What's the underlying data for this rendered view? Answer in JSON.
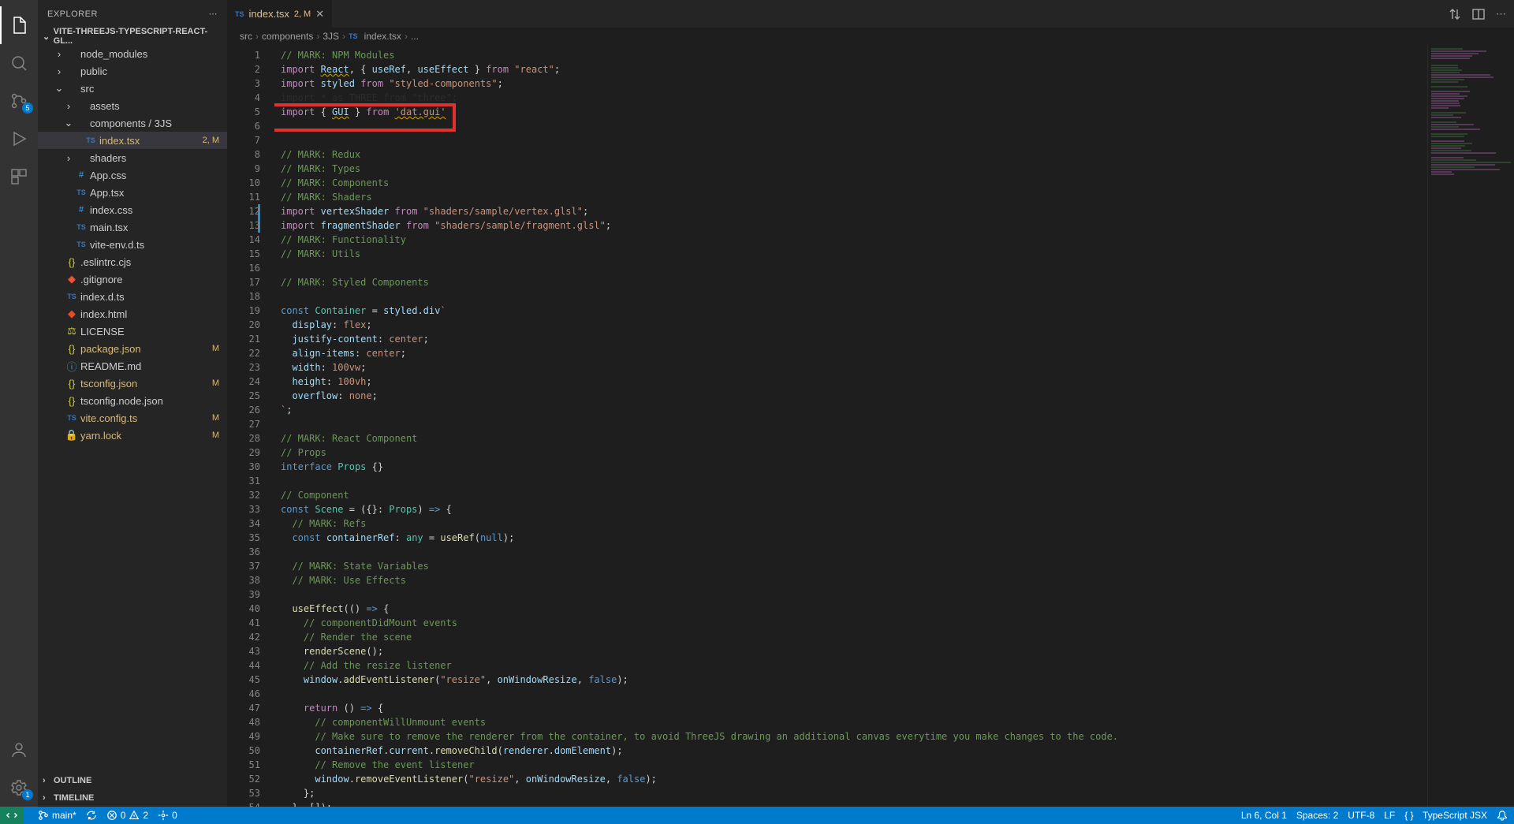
{
  "explorer": {
    "title": "EXPLORER",
    "project": "VITE-THREEJS-TYPESCRIPT-REACT-GL...",
    "outline": "OUTLINE",
    "timeline": "TIMELINE"
  },
  "tree": [
    {
      "depth": 1,
      "chev": "›",
      "icon": "folder",
      "label": "node_modules",
      "cls": ""
    },
    {
      "depth": 1,
      "chev": "›",
      "icon": "folder",
      "label": "public",
      "cls": ""
    },
    {
      "depth": 1,
      "chev": "⌄",
      "icon": "folder",
      "label": "src",
      "cls": ""
    },
    {
      "depth": 2,
      "chev": "›",
      "icon": "folder",
      "label": "assets",
      "cls": ""
    },
    {
      "depth": 2,
      "chev": "⌄",
      "icon": "folder",
      "label": "components / 3JS",
      "cls": ""
    },
    {
      "depth": 3,
      "chev": "",
      "icon": "ts",
      "label": "index.tsx",
      "cls": "mod",
      "status": "2, M",
      "selected": true
    },
    {
      "depth": 2,
      "chev": "›",
      "icon": "folder",
      "label": "shaders",
      "cls": ""
    },
    {
      "depth": 2,
      "chev": "",
      "icon": "css",
      "label": "App.css",
      "cls": ""
    },
    {
      "depth": 2,
      "chev": "",
      "icon": "ts",
      "label": "App.tsx",
      "cls": ""
    },
    {
      "depth": 2,
      "chev": "",
      "icon": "css",
      "label": "index.css",
      "cls": ""
    },
    {
      "depth": 2,
      "chev": "",
      "icon": "ts",
      "label": "main.tsx",
      "cls": ""
    },
    {
      "depth": 2,
      "chev": "",
      "icon": "ts",
      "label": "vite-env.d.ts",
      "cls": ""
    },
    {
      "depth": 1,
      "chev": "",
      "icon": "json",
      "label": ".eslintrc.cjs",
      "cls": ""
    },
    {
      "depth": 1,
      "chev": "",
      "icon": "git",
      "label": ".gitignore",
      "cls": ""
    },
    {
      "depth": 1,
      "chev": "",
      "icon": "ts",
      "label": "index.d.ts",
      "cls": ""
    },
    {
      "depth": 1,
      "chev": "",
      "icon": "html",
      "label": "index.html",
      "cls": ""
    },
    {
      "depth": 1,
      "chev": "",
      "icon": "lic",
      "label": "LICENSE",
      "cls": ""
    },
    {
      "depth": 1,
      "chev": "",
      "icon": "json",
      "label": "package.json",
      "cls": "mod",
      "status": "M"
    },
    {
      "depth": 1,
      "chev": "",
      "icon": "md",
      "label": "README.md",
      "cls": ""
    },
    {
      "depth": 1,
      "chev": "",
      "icon": "json",
      "label": "tsconfig.json",
      "cls": "mod",
      "status": "M"
    },
    {
      "depth": 1,
      "chev": "",
      "icon": "json",
      "label": "tsconfig.node.json",
      "cls": ""
    },
    {
      "depth": 1,
      "chev": "",
      "icon": "ts",
      "label": "vite.config.ts",
      "cls": "mod",
      "status": "M"
    },
    {
      "depth": 1,
      "chev": "",
      "icon": "lock",
      "label": "yarn.lock",
      "cls": "mod",
      "status": "M"
    }
  ],
  "tab": {
    "label": "index.tsx",
    "meta": "2, M"
  },
  "breadcrumbs": [
    "src",
    "components",
    "3JS",
    "index.tsx",
    "..."
  ],
  "badges": {
    "scm": "5",
    "settings": "1"
  },
  "status": {
    "branch": "main*",
    "sync": "",
    "errors": "0",
    "warnings": "2",
    "ports": "0",
    "position": "Ln 6, Col 1",
    "spaces": "Spaces: 2",
    "encoding": "UTF-8",
    "eol": "LF",
    "language": "TypeScript JSX"
  },
  "code": [
    {
      "n": 1,
      "t": "comment",
      "html": "// MARK: NPM Modules"
    },
    {
      "n": 2,
      "t": "code",
      "html": "<span class='c-keyword'>import</span> <span class='c-var underline-warn'>React</span>, { <span class='c-var'>useRef</span>, <span class='c-var'>useEffect</span> } <span class='c-keyword'>from</span> <span class='c-string'>\"react\"</span>;"
    },
    {
      "n": 3,
      "t": "code",
      "html": "<span class='c-keyword'>import</span> <span class='c-var'>styled</span> <span class='c-keyword'>from</span> <span class='c-string'>\"styled-components\"</span>;"
    },
    {
      "n": 4,
      "t": "code",
      "html": "<span class='dim'>import * as THREE from \"three\";</span>",
      "hidden": true
    },
    {
      "n": 5,
      "t": "code",
      "html": "<span class='c-keyword'>import</span> { <span class='c-var underline-warn'>GUI</span> } <span class='c-keyword'>from</span> <span class='c-string underline-warn'>'dat.gui'</span>",
      "box": true
    },
    {
      "n": 6,
      "t": "blank",
      "html": ""
    },
    {
      "n": 7,
      "t": "blank",
      "html": ""
    },
    {
      "n": 8,
      "t": "comment",
      "html": "// MARK: Redux"
    },
    {
      "n": 9,
      "t": "comment",
      "html": "// MARK: Types"
    },
    {
      "n": 10,
      "t": "comment",
      "html": "// MARK: Components"
    },
    {
      "n": 11,
      "t": "comment",
      "html": "// MARK: Shaders"
    },
    {
      "n": 12,
      "t": "code",
      "mod": true,
      "html": "<span class='c-keyword'>import</span> <span class='c-var'>vertexShader</span> <span class='c-keyword'>from</span> <span class='c-string'>\"shaders/sample/vertex.glsl\"</span>;"
    },
    {
      "n": 13,
      "t": "code",
      "mod": true,
      "html": "<span class='c-keyword'>import</span> <span class='c-var'>fragmentShader</span> <span class='c-keyword'>from</span> <span class='c-string'>\"shaders/sample/fragment.glsl\"</span>;"
    },
    {
      "n": 14,
      "t": "comment",
      "html": "// MARK: Functionality"
    },
    {
      "n": 15,
      "t": "comment",
      "html": "// MARK: Utils"
    },
    {
      "n": 16,
      "t": "blank",
      "html": ""
    },
    {
      "n": 17,
      "t": "comment",
      "html": "// MARK: Styled Components"
    },
    {
      "n": 18,
      "t": "blank",
      "html": ""
    },
    {
      "n": 19,
      "t": "code",
      "html": "<span class='c-const'>const</span> <span class='c-type'>Container</span> = <span class='c-var'>styled</span>.<span class='c-var'>div</span><span class='c-string'>`</span>"
    },
    {
      "n": 20,
      "t": "code",
      "html": "  <span class='c-var'>display</span>: <span class='c-string'>flex</span>;"
    },
    {
      "n": 21,
      "t": "code",
      "html": "  <span class='c-var'>justify-content</span>: <span class='c-string'>center</span>;"
    },
    {
      "n": 22,
      "t": "code",
      "html": "  <span class='c-var'>align-items</span>: <span class='c-string'>center</span>;"
    },
    {
      "n": 23,
      "t": "code",
      "html": "  <span class='c-var'>width</span>: <span class='c-string'>100vw</span>;"
    },
    {
      "n": 24,
      "t": "code",
      "html": "  <span class='c-var'>height</span>: <span class='c-string'>100vh</span>;"
    },
    {
      "n": 25,
      "t": "code",
      "html": "  <span class='c-var'>overflow</span>: <span class='c-string'>none</span>;"
    },
    {
      "n": 26,
      "t": "code",
      "html": "<span class='c-string'>`</span>;"
    },
    {
      "n": 27,
      "t": "blank",
      "html": ""
    },
    {
      "n": 28,
      "t": "comment",
      "html": "// MARK: React Component"
    },
    {
      "n": 29,
      "t": "comment",
      "html": "// Props"
    },
    {
      "n": 30,
      "t": "code",
      "html": "<span class='c-const'>interface</span> <span class='c-type'>Props</span> {}"
    },
    {
      "n": 31,
      "t": "blank",
      "html": ""
    },
    {
      "n": 32,
      "t": "comment",
      "html": "// Component"
    },
    {
      "n": 33,
      "t": "code",
      "html": "<span class='c-const'>const</span> <span class='c-type'>Scene</span> = ({}: <span class='c-type'>Props</span>) <span class='c-const'>=&gt;</span> {"
    },
    {
      "n": 34,
      "t": "comment",
      "html": "  // MARK: Refs"
    },
    {
      "n": 35,
      "t": "code",
      "html": "  <span class='c-const'>const</span> <span class='c-var'>containerRef</span>: <span class='c-type'>any</span> = <span class='c-func'>useRef</span>(<span class='c-const'>null</span>);"
    },
    {
      "n": 36,
      "t": "blank",
      "html": ""
    },
    {
      "n": 37,
      "t": "comment",
      "html": "  // MARK: State Variables"
    },
    {
      "n": 38,
      "t": "comment",
      "html": "  // MARK: Use Effects"
    },
    {
      "n": 39,
      "t": "blank",
      "html": ""
    },
    {
      "n": 40,
      "t": "code",
      "html": "  <span class='c-func'>useEffect</span>(() <span class='c-const'>=&gt;</span> {"
    },
    {
      "n": 41,
      "t": "comment",
      "html": "    // componentDidMount events"
    },
    {
      "n": 42,
      "t": "comment",
      "html": "    // Render the scene"
    },
    {
      "n": 43,
      "t": "code",
      "html": "    <span class='c-func'>renderScene</span>();"
    },
    {
      "n": 44,
      "t": "comment",
      "html": "    // Add the resize listener"
    },
    {
      "n": 45,
      "t": "code",
      "html": "    <span class='c-var'>window</span>.<span class='c-func'>addEventListener</span>(<span class='c-string'>\"resize\"</span>, <span class='c-var'>onWindowResize</span>, <span class='c-const'>false</span>);"
    },
    {
      "n": 46,
      "t": "blank",
      "html": ""
    },
    {
      "n": 47,
      "t": "code",
      "html": "    <span class='c-keyword'>return</span> () <span class='c-const'>=&gt;</span> {"
    },
    {
      "n": 48,
      "t": "comment",
      "html": "      // componentWillUnmount events"
    },
    {
      "n": 49,
      "t": "comment",
      "html": "      // Make sure to remove the renderer from the container, to avoid ThreeJS drawing an additional canvas everytime you make changes to the code."
    },
    {
      "n": 50,
      "t": "code",
      "html": "      <span class='c-var'>containerRef</span>.<span class='c-var'>current</span>.<span class='c-func'>removeChild</span>(<span class='c-var'>renderer</span>.<span class='c-var'>domElement</span>);"
    },
    {
      "n": 51,
      "t": "comment",
      "html": "      // Remove the event listener"
    },
    {
      "n": 52,
      "t": "code",
      "html": "      <span class='c-var'>window</span>.<span class='c-func'>removeEventListener</span>(<span class='c-string'>\"resize\"</span>, <span class='c-var'>onWindowResize</span>, <span class='c-const'>false</span>);"
    },
    {
      "n": 53,
      "t": "code",
      "html": "    };"
    },
    {
      "n": 54,
      "t": "code",
      "html": "  }, []);"
    }
  ]
}
